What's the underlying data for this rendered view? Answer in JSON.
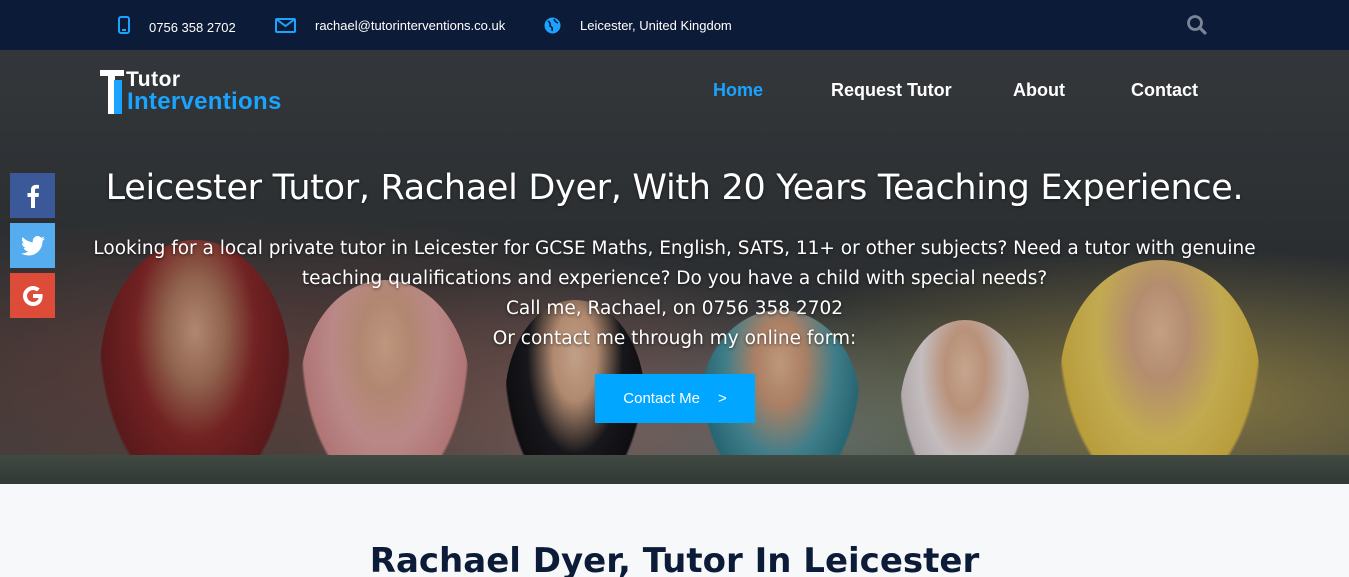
{
  "topbar": {
    "phone": "0756 358 2702",
    "email": "rachael@tutorinterventions.co.uk",
    "location": "Leicester, United Kingdom",
    "icons": [
      "phone-icon",
      "envelope-icon",
      "globe-icon",
      "search-icon"
    ]
  },
  "brand": {
    "line1": "Tutor",
    "line2": "Interventions",
    "colors": {
      "navy": "#0c1b37",
      "accent": "#1aa3ff"
    }
  },
  "nav": {
    "items": [
      {
        "label": "Home",
        "active": true
      },
      {
        "label": "Request Tutor",
        "active": false
      },
      {
        "label": "About",
        "active": false
      },
      {
        "label": "Contact",
        "active": false
      }
    ]
  },
  "social": {
    "facebook": {
      "icon": "facebook-icon",
      "color": "#3b5998"
    },
    "twitter": {
      "icon": "twitter-icon",
      "color": "#55acee"
    },
    "google": {
      "icon": "google-icon",
      "color": "#dd4b39"
    }
  },
  "hero": {
    "title": "Leicester Tutor, Rachael Dyer, With 20 Years Teaching Experience.",
    "line1": "Looking for a local private tutor in Leicester for GCSE Maths, English, SATS, 11+ or other subjects? Need a tutor with genuine",
    "line2": "teaching qualifications and experience? Do you have a child with special needs?",
    "line3": "Call me, Rachael, on 0756 358 2702",
    "line4": "Or contact me through my online form:",
    "cta_label": "Contact Me",
    "cta_arrow": ">"
  },
  "section": {
    "title": "Rachael Dyer, Tutor In Leicester"
  }
}
